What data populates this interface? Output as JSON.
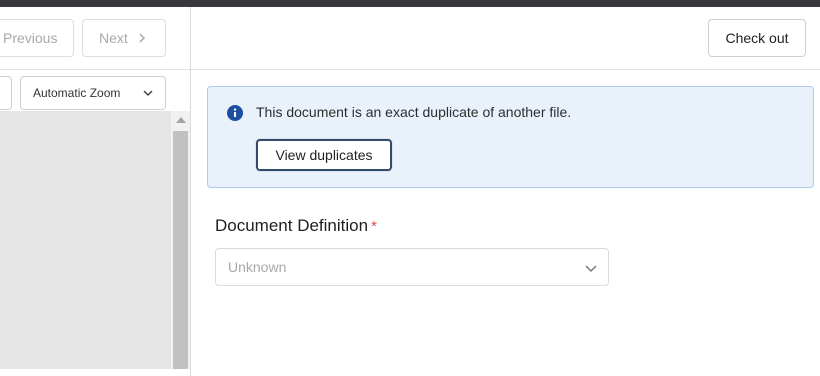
{
  "toolbar": {
    "previous_label": "Previous",
    "next_label": "Next",
    "zoom_value": "Automatic Zoom"
  },
  "header": {
    "checkout_label": "Check out"
  },
  "alert": {
    "message": "This document is an exact duplicate of another file.",
    "view_duplicates_label": "View duplicates"
  },
  "form": {
    "document_definition_label": "Document Definition",
    "required_marker": "*",
    "document_definition_placeholder": "Unknown"
  },
  "icons": {
    "next": "chevron-right-icon",
    "zoom_dropdown": "chevron-down-icon",
    "alert": "info-icon",
    "select_dropdown": "chevron-down-icon"
  },
  "colors": {
    "topbar": "#37373d",
    "alert_background": "#e9f1fb",
    "alert_border": "#aecbec",
    "info_icon": "#1f4fa0",
    "required": "#d9534f",
    "viewer_background": "#e6e6e6"
  }
}
